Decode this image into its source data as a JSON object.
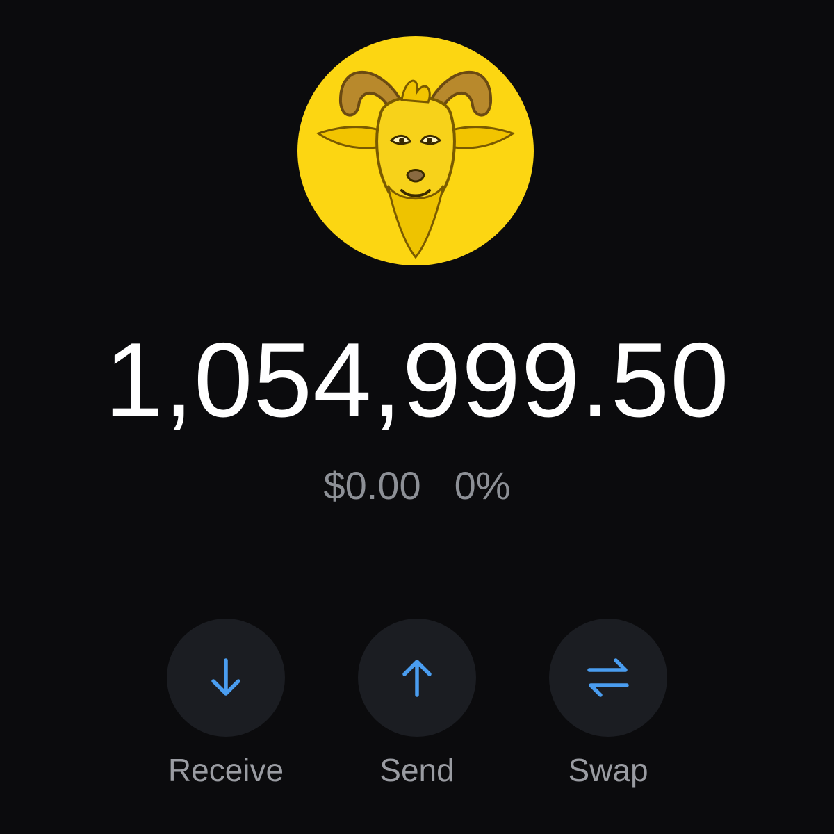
{
  "token": {
    "logo_icon": "goat-logo-icon",
    "logo_color": "#fcd612"
  },
  "balance": {
    "amount": "1,054,999.50",
    "fiat_value": "$0.00",
    "change_percent": "0%"
  },
  "actions": [
    {
      "label": "Receive",
      "icon": "arrow-down-icon"
    },
    {
      "label": "Send",
      "icon": "arrow-up-icon"
    },
    {
      "label": "Swap",
      "icon": "swap-arrows-icon"
    }
  ],
  "colors": {
    "background": "#0b0b0d",
    "accent": "#4a9df0",
    "button_bg": "#1b1d22",
    "muted_text": "#8d9096"
  }
}
